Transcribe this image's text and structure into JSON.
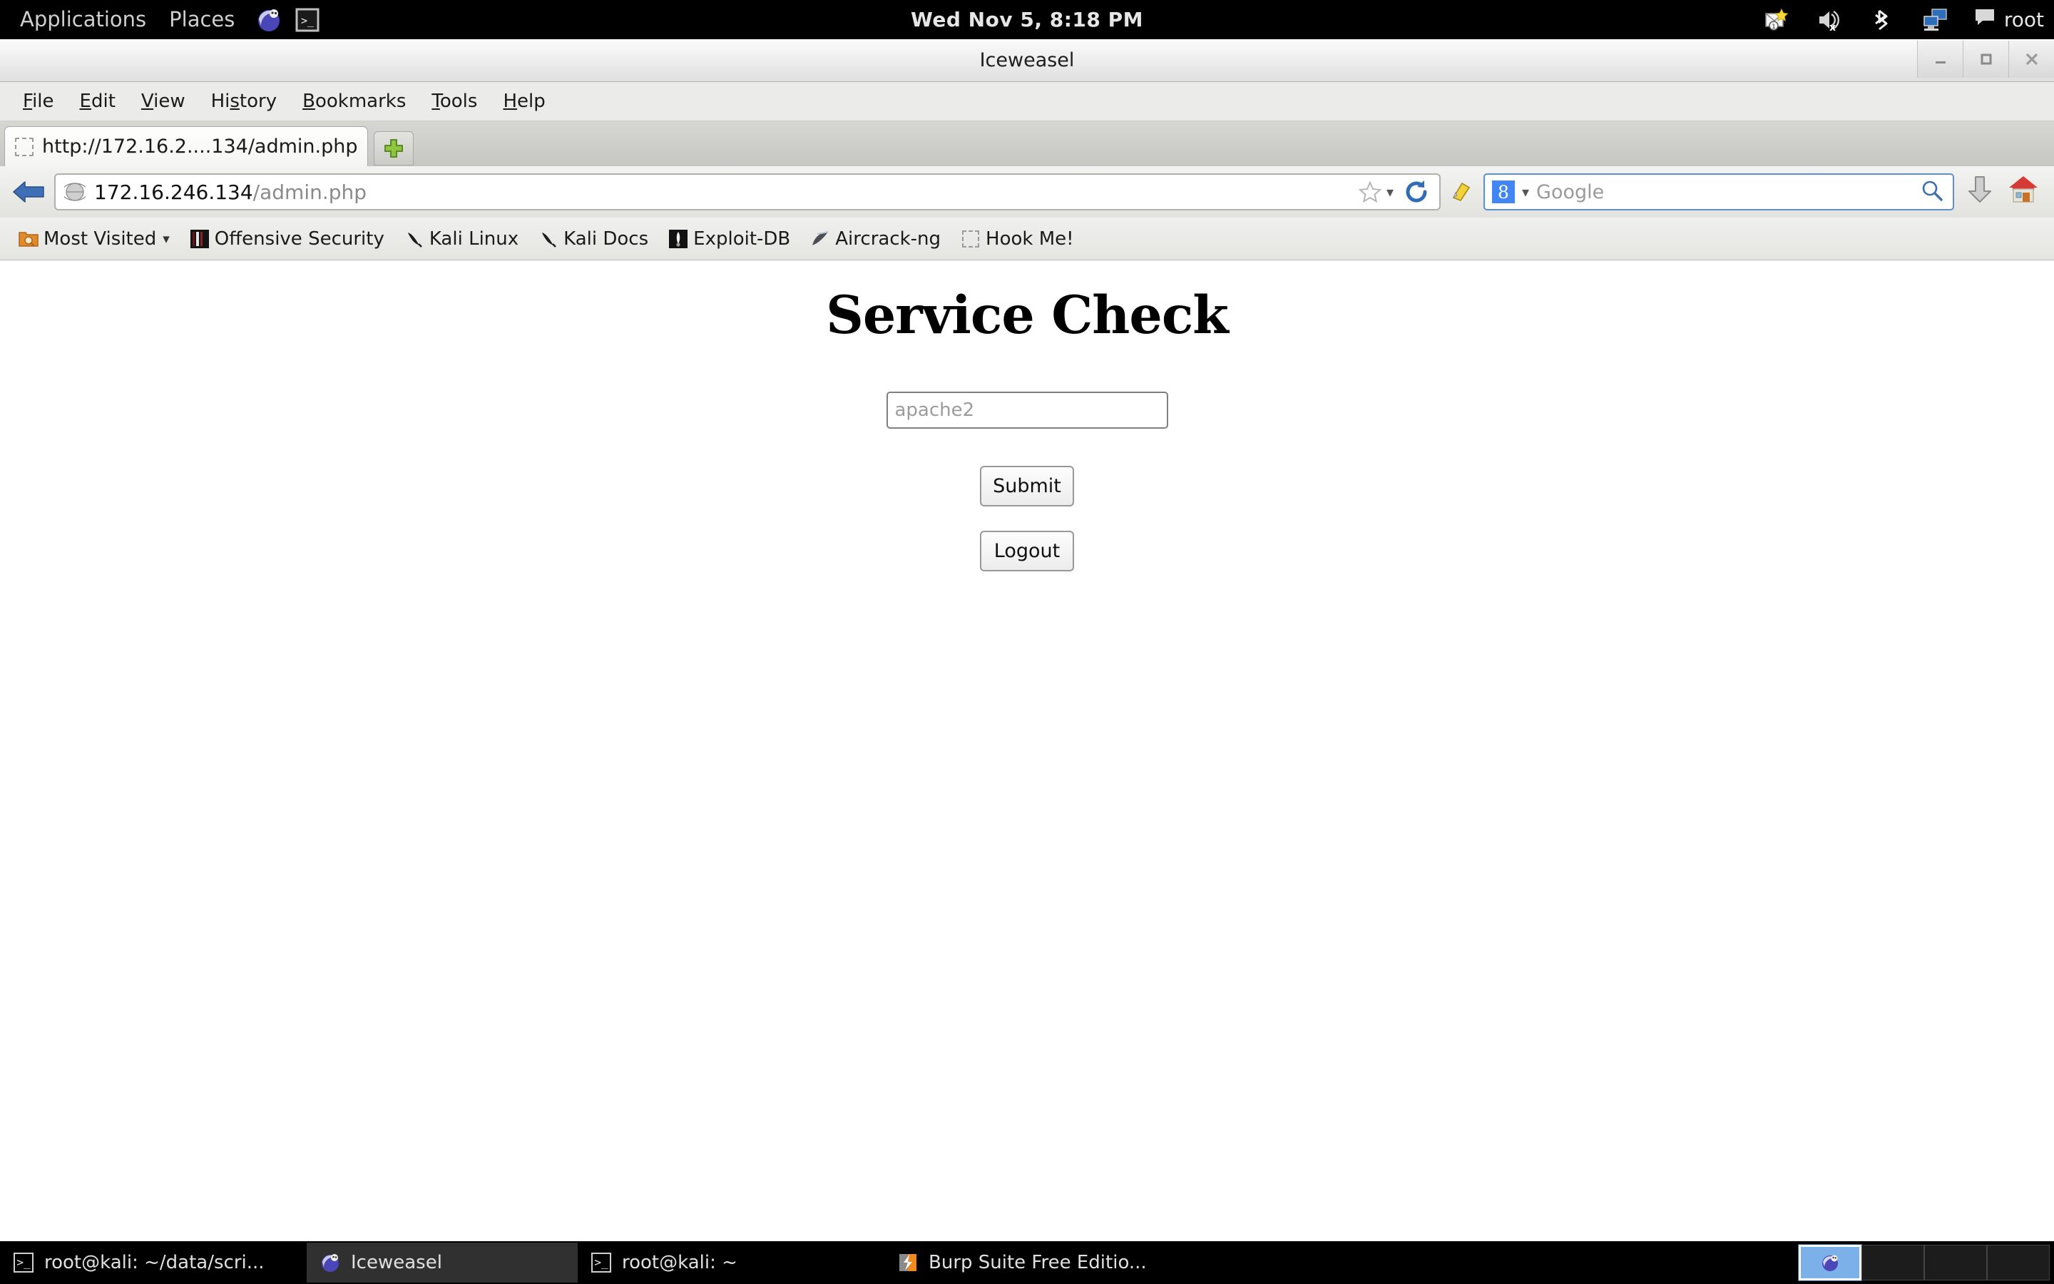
{
  "desktop": {
    "top_panel": {
      "menus": [
        {
          "label": "Applications",
          "name": "applications-menu"
        },
        {
          "label": "Places",
          "name": "places-menu"
        }
      ],
      "launchers": [
        {
          "name": "iceweasel-launcher-icon",
          "icon": "iceweasel-icon"
        },
        {
          "name": "terminal-launcher-icon",
          "icon": "terminal-icon"
        }
      ],
      "clock": "Wed Nov  5,  8:18 PM",
      "tray": [
        {
          "name": "mail-notification-icon",
          "icon": "envelope-star-icon"
        },
        {
          "name": "volume-muted-icon",
          "icon": "speaker-mute-icon"
        },
        {
          "name": "bluetooth-icon",
          "icon": "bluetooth-icon"
        },
        {
          "name": "network-icon",
          "icon": "two-monitors-icon"
        }
      ],
      "user": "root",
      "user_icon": "chat-bubble-icon"
    },
    "taskbar": {
      "tasks": [
        {
          "label": "root@kali: ~/data/scri...",
          "icon": "terminal-icon",
          "active": false,
          "name": "task-terminal-1"
        },
        {
          "label": "Iceweasel",
          "icon": "iceweasel-icon",
          "active": true,
          "name": "task-iceweasel"
        },
        {
          "label": "root@kali: ~",
          "icon": "terminal-icon",
          "active": false,
          "name": "task-terminal-2"
        },
        {
          "label": "Burp Suite Free Editio...",
          "icon": "burp-icon",
          "active": false,
          "name": "task-burpsuite"
        }
      ],
      "workspaces": [
        {
          "active": true,
          "icon": "iceweasel-icon"
        },
        {
          "active": false,
          "icon": ""
        },
        {
          "active": false,
          "icon": ""
        },
        {
          "active": false,
          "icon": ""
        }
      ]
    }
  },
  "browser": {
    "window_title": "Iceweasel",
    "window_controls": [
      {
        "name": "minimize-button",
        "glyph": "minimize"
      },
      {
        "name": "maximize-button",
        "glyph": "maximize"
      },
      {
        "name": "close-button",
        "glyph": "close"
      }
    ],
    "menubar": [
      {
        "label": "File",
        "accel": "F"
      },
      {
        "label": "Edit",
        "accel": "E"
      },
      {
        "label": "View",
        "accel": "V"
      },
      {
        "label": "History",
        "accel": "s"
      },
      {
        "label": "Bookmarks",
        "accel": "B"
      },
      {
        "label": "Tools",
        "accel": "T"
      },
      {
        "label": "Help",
        "accel": "H"
      }
    ],
    "tabs": [
      {
        "label": "http://172.16.2....134/admin.php",
        "active": true
      }
    ],
    "new_tab_label": "+",
    "urlbar": {
      "domain": "172.16.246.134",
      "path": "/admin.php",
      "full": "172.16.246.134/admin.php"
    },
    "searchbar": {
      "engine": "Google",
      "engine_glyph": "8",
      "placeholder": "Google"
    },
    "bookmarks": [
      {
        "label": "Most Visited",
        "icon": "most-visited-folder-icon",
        "dropdown": true
      },
      {
        "label": "Offensive Security",
        "icon": "offensive-security-icon",
        "dropdown": false
      },
      {
        "label": "Kali Linux",
        "icon": "kali-dragon-icon",
        "dropdown": false
      },
      {
        "label": "Kali Docs",
        "icon": "kali-dragon-icon",
        "dropdown": false
      },
      {
        "label": "Exploit-DB",
        "icon": "exploit-db-icon",
        "dropdown": false
      },
      {
        "label": "Aircrack-ng",
        "icon": "aircrack-ng-icon",
        "dropdown": false
      },
      {
        "label": "Hook Me!",
        "icon": "blank-favicon-icon",
        "dropdown": false
      }
    ]
  },
  "page": {
    "heading": "Service Check",
    "service_input": {
      "value": "",
      "placeholder": "apache2"
    },
    "submit_label": "Submit",
    "logout_label": "Logout"
  },
  "colors": {
    "panel_bg": "#000000",
    "chrome_bg": "#e7e7e4",
    "page_bg": "#ffffff",
    "accent_blue": "#4285f4",
    "workspace_active": "#7cb0e8"
  }
}
